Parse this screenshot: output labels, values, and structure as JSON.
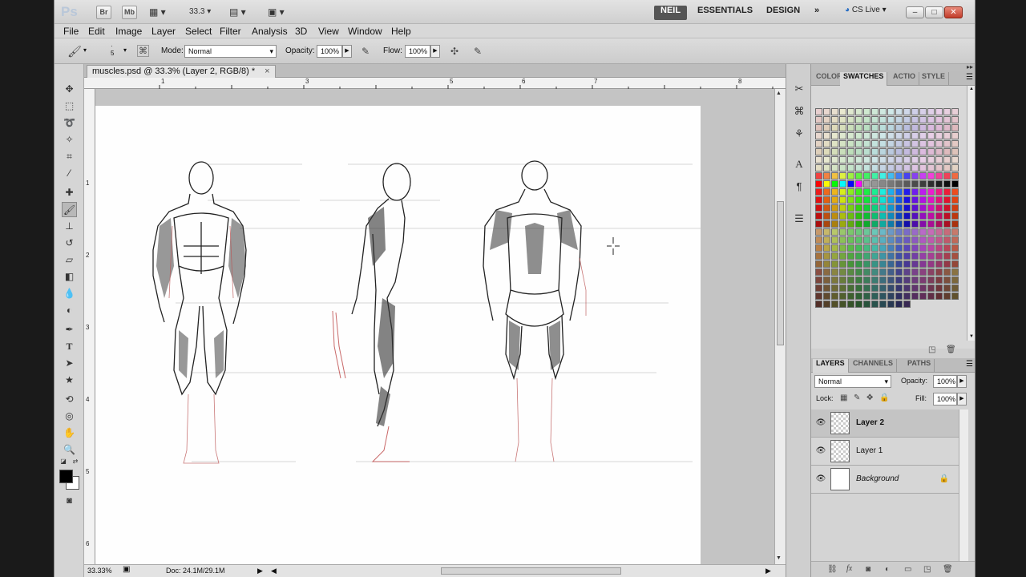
{
  "app": {
    "logo": "Ps",
    "launch_buttons": [
      "Br",
      "Mb"
    ],
    "zoom_level": "33.3",
    "workspaces": [
      "NEIL",
      "ESSENTIALS",
      "DESIGN"
    ],
    "more": "»",
    "cs_live": "CS Live",
    "window_controls": [
      "–",
      "□",
      "✕"
    ]
  },
  "menu": [
    "File",
    "Edit",
    "Image",
    "Layer",
    "Select",
    "Filter",
    "Analysis",
    "3D",
    "View",
    "Window",
    "Help"
  ],
  "options": {
    "brush_size": "5",
    "mode_label": "Mode:",
    "mode_value": "Normal",
    "opacity_label": "Opacity:",
    "opacity_value": "100%",
    "flow_label": "Flow:",
    "flow_value": "100%"
  },
  "document": {
    "tab_title": "muscles.psd @ 33.3% (Layer 2, RGB/8) *",
    "tab_close": "×",
    "ruler_h": [
      "1",
      "3",
      "5",
      "6",
      "7",
      "8"
    ],
    "ruler_v": [
      "1",
      "2",
      "3",
      "4",
      "5",
      "6"
    ]
  },
  "status": {
    "zoom": "33.33%",
    "doc_info": "Doc: 24.1M/29.1M"
  },
  "swatches_panel": {
    "tabs": [
      "COLOR",
      "SWATCHES",
      "ACTIO",
      "STYLE"
    ]
  },
  "layers_panel": {
    "tabs": [
      "LAYERS",
      "CHANNELS",
      "PATHS"
    ],
    "blend_mode": "Normal",
    "opacity_label": "Opacity:",
    "opacity_value": "100%",
    "lock_label": "Lock:",
    "fill_label": "Fill:",
    "fill_value": "100%",
    "layers": [
      {
        "name": "Layer 2",
        "selected": true
      },
      {
        "name": "Layer 1",
        "selected": false
      },
      {
        "name": "Background",
        "selected": false
      }
    ]
  }
}
